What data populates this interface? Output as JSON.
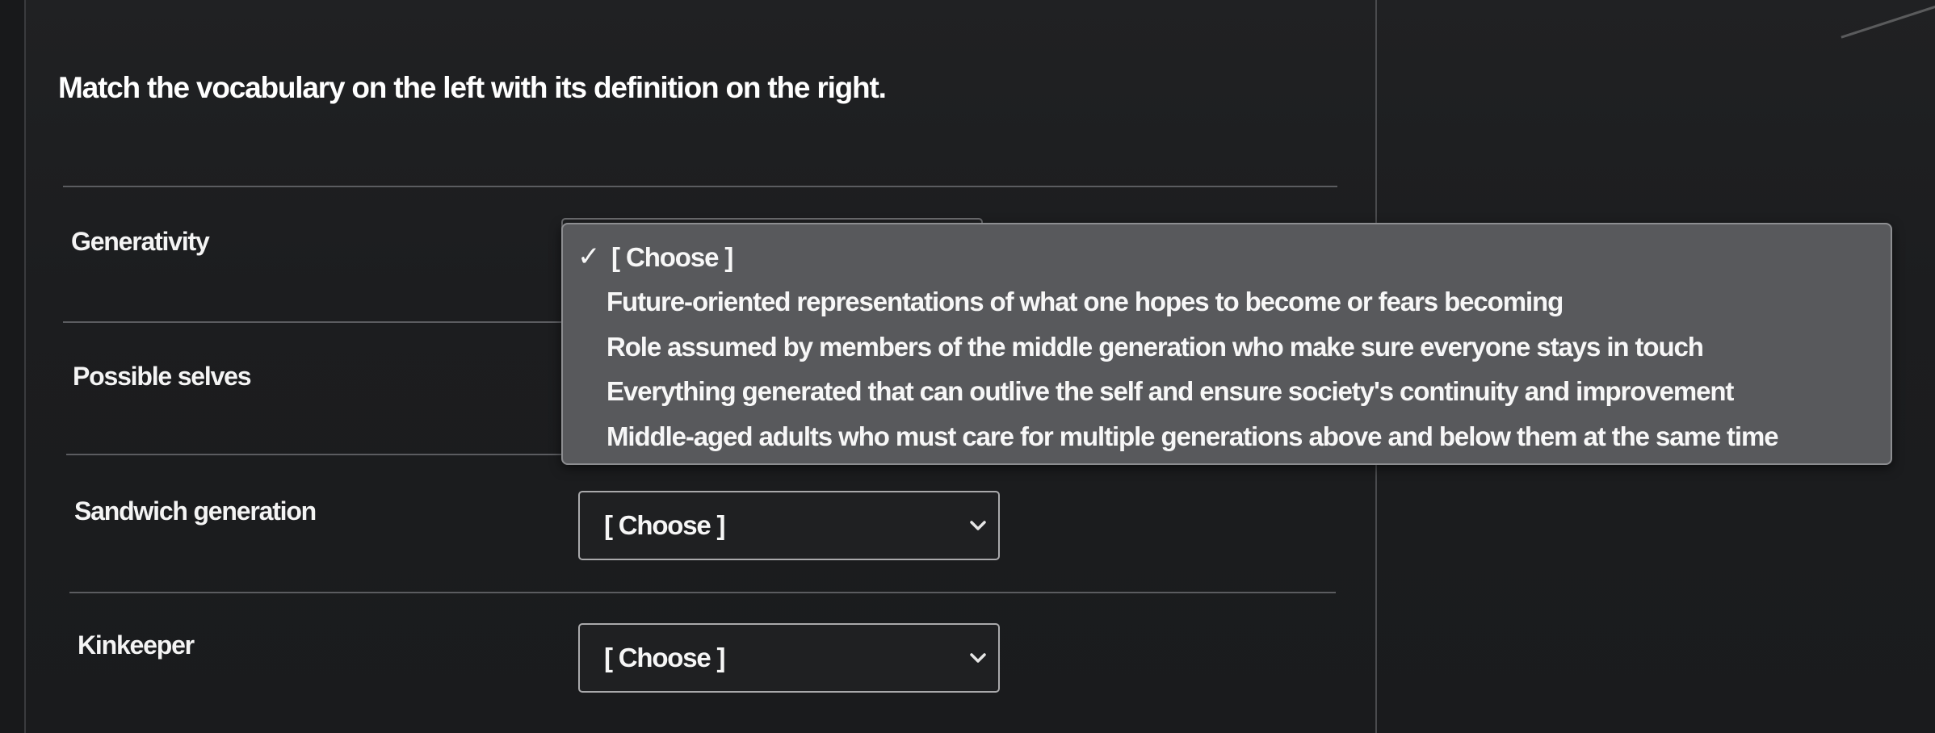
{
  "question": {
    "text": "Match the vocabulary on the left with its definition on the right."
  },
  "rows": [
    {
      "term": "Generativity",
      "selected": "[ Choose ]"
    },
    {
      "term": "Possible selves",
      "selected": "[ Choose ]"
    },
    {
      "term": "Sandwich generation",
      "selected": "[ Choose ]"
    },
    {
      "term": "Kinkeeper",
      "selected": "[ Choose ]"
    }
  ],
  "dropdown": {
    "check_glyph": "✓",
    "options": [
      "[ Choose ]",
      "Future-oriented representations of what one hopes to become or fears becoming",
      "Role assumed by members of the middle generation who make sure everyone stays in touch",
      "Everything generated that can outlive the self and ensure society's continuity and improvement",
      "Middle-aged adults who must care for multiple generations above and below them at the same time"
    ]
  },
  "icons": {
    "select_caret": "chevron-down-icon",
    "selected_marker": "checkmark-icon"
  },
  "colors": {
    "background": "#1c1d1f",
    "dropdown_bg": "#58595c",
    "text": "#f4f4f4",
    "border": "#a9a9ab"
  }
}
